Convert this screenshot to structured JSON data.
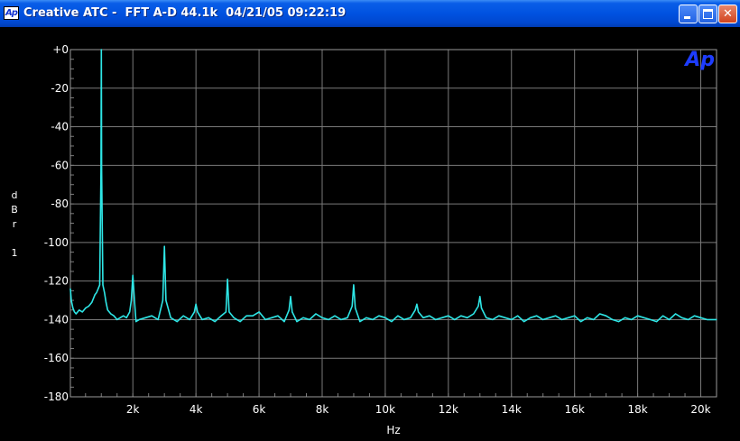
{
  "window": {
    "icon_text": "Ap",
    "title": "Creative ATC -  FFT A-D 44.1k  04/21/05 09:22:19",
    "buttons": {
      "minimize": "_",
      "maximize": "□",
      "close": "✕"
    }
  },
  "plot": {
    "logo": "Ap",
    "y_axis_label_chars": [
      "d",
      "B",
      "r"
    ],
    "channel": "1",
    "x_axis_label": "Hz",
    "colors": {
      "trace": "#2ee6e6",
      "grid": "#7a7a7a",
      "background": "#000000",
      "logo": "#1d3cff",
      "text": "#ffffff"
    }
  },
  "chart_data": {
    "type": "line",
    "xlabel": "Hz",
    "ylabel": "dBr",
    "xlim": [
      20,
      20500
    ],
    "ylim": [
      -180,
      0
    ],
    "x_tick_labels": [
      "2k",
      "4k",
      "6k",
      "8k",
      "10k",
      "12k",
      "14k",
      "16k",
      "18k",
      "20k"
    ],
    "x_tick_values": [
      2000,
      4000,
      6000,
      8000,
      10000,
      12000,
      14000,
      16000,
      18000,
      20000
    ],
    "y_tick_labels": [
      "+0",
      "-20",
      "-40",
      "-60",
      "-80",
      "-100",
      "-120",
      "-140",
      "-160",
      "-180"
    ],
    "y_tick_values": [
      0,
      -20,
      -40,
      -60,
      -80,
      -100,
      -120,
      -140,
      -160,
      -180
    ],
    "grid": true,
    "series": [
      {
        "color": "#2ee6e6",
        "x": [
          20,
          50,
          100,
          150,
          200,
          300,
          400,
          500,
          600,
          700,
          800,
          850,
          900,
          950,
          990,
          1000,
          1010,
          1050,
          1100,
          1150,
          1200,
          1300,
          1400,
          1500,
          1600,
          1700,
          1800,
          1900,
          1950,
          2000,
          2050,
          2100,
          2200,
          2400,
          2600,
          2800,
          2950,
          3000,
          3050,
          3200,
          3400,
          3600,
          3800,
          3950,
          4000,
          4050,
          4200,
          4400,
          4600,
          4800,
          4950,
          5000,
          5050,
          5200,
          5400,
          5600,
          5800,
          6000,
          6200,
          6400,
          6600,
          6800,
          6950,
          7000,
          7050,
          7200,
          7400,
          7600,
          7800,
          8000,
          8200,
          8400,
          8600,
          8800,
          8950,
          9000,
          9050,
          9200,
          9400,
          9600,
          9800,
          10000,
          10200,
          10400,
          10600,
          10800,
          10950,
          11000,
          11050,
          11200,
          11400,
          11600,
          11800,
          12000,
          12200,
          12400,
          12600,
          12800,
          12950,
          13000,
          13050,
          13200,
          13400,
          13600,
          13800,
          14000,
          14200,
          14400,
          14600,
          14800,
          15000,
          15200,
          15400,
          15600,
          15800,
          16000,
          16200,
          16400,
          16600,
          16800,
          17000,
          17200,
          17400,
          17600,
          17800,
          18000,
          18200,
          18400,
          18600,
          18800,
          19000,
          19200,
          19400,
          19600,
          19800,
          20000,
          20200,
          20500
        ],
        "y": [
          -124,
          -130,
          -134,
          -136,
          -137,
          -135,
          -136,
          -134,
          -133,
          -131,
          -127,
          -126,
          -124,
          -122,
          -62,
          0,
          -62,
          -122,
          -126,
          -131,
          -135,
          -137,
          -138,
          -140,
          -139,
          -138,
          -139,
          -136,
          -130,
          -117,
          -130,
          -141,
          -140,
          -139,
          -138,
          -140,
          -130,
          -102,
          -130,
          -139,
          -141,
          -138,
          -140,
          -136,
          -132,
          -136,
          -140,
          -139,
          -141,
          -138,
          -136,
          -119,
          -136,
          -139,
          -141,
          -138,
          -138,
          -136,
          -140,
          -139,
          -138,
          -141,
          -135,
          -128,
          -136,
          -141,
          -139,
          -140,
          -137,
          -139,
          -140,
          -138,
          -140,
          -139,
          -133,
          -122,
          -134,
          -141,
          -139,
          -140,
          -138,
          -139,
          -141,
          -138,
          -140,
          -139,
          -135,
          -132,
          -136,
          -139,
          -138,
          -140,
          -139,
          -138,
          -140,
          -138,
          -139,
          -137,
          -133,
          -128,
          -134,
          -139,
          -140,
          -138,
          -139,
          -140,
          -138,
          -141,
          -139,
          -138,
          -140,
          -139,
          -138,
          -140,
          -139,
          -138,
          -141,
          -139,
          -140,
          -137,
          -138,
          -140,
          -141,
          -139,
          -140,
          -138,
          -139,
          -140,
          -141,
          -138,
          -140,
          -137,
          -139,
          -140,
          -138,
          -139,
          -140,
          -140
        ]
      }
    ]
  }
}
